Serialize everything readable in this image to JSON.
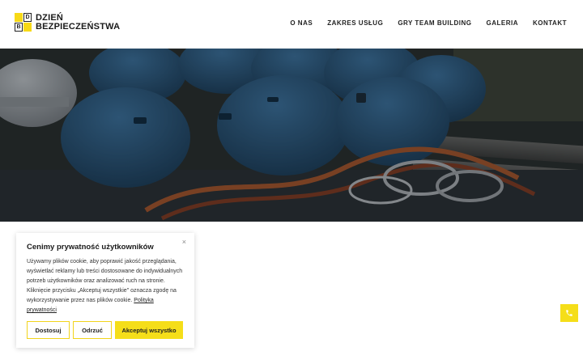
{
  "brand": {
    "logo_letters": [
      "D",
      "B"
    ],
    "name_line1": "DZIEŃ",
    "name_line2": "BEZPIECZEŃSTWA",
    "accent_color": "#f5de19"
  },
  "nav": {
    "items": [
      {
        "label": "O NAS"
      },
      {
        "label": "ZAKRES USŁUG"
      },
      {
        "label": "GRY TEAM BUILDING"
      },
      {
        "label": "GALERIA"
      },
      {
        "label": "KONTAKT"
      }
    ]
  },
  "hero": {
    "image_subject": "climbing helmets and ropes"
  },
  "cookie": {
    "title": "Cenimy prywatność użytkowników",
    "close_icon": "close-icon",
    "text": "Używamy plików cookie, aby poprawić jakość przeglądania, wyświetlać reklamy lub treści dostosowane do indywidualnych potrzeb użytkowników oraz analizować ruch na stronie. Kliknięcie przycisku „Akceptuj wszystkie\" oznacza zgodę na wykorzystywanie przez nas plików cookie.",
    "link_text": "Polityka prywatności",
    "buttons": {
      "customize": "Dostosuj",
      "reject": "Odrzuć",
      "accept": "Akceptuj wszystko"
    }
  },
  "floating": {
    "phone_icon": "phone-icon"
  }
}
